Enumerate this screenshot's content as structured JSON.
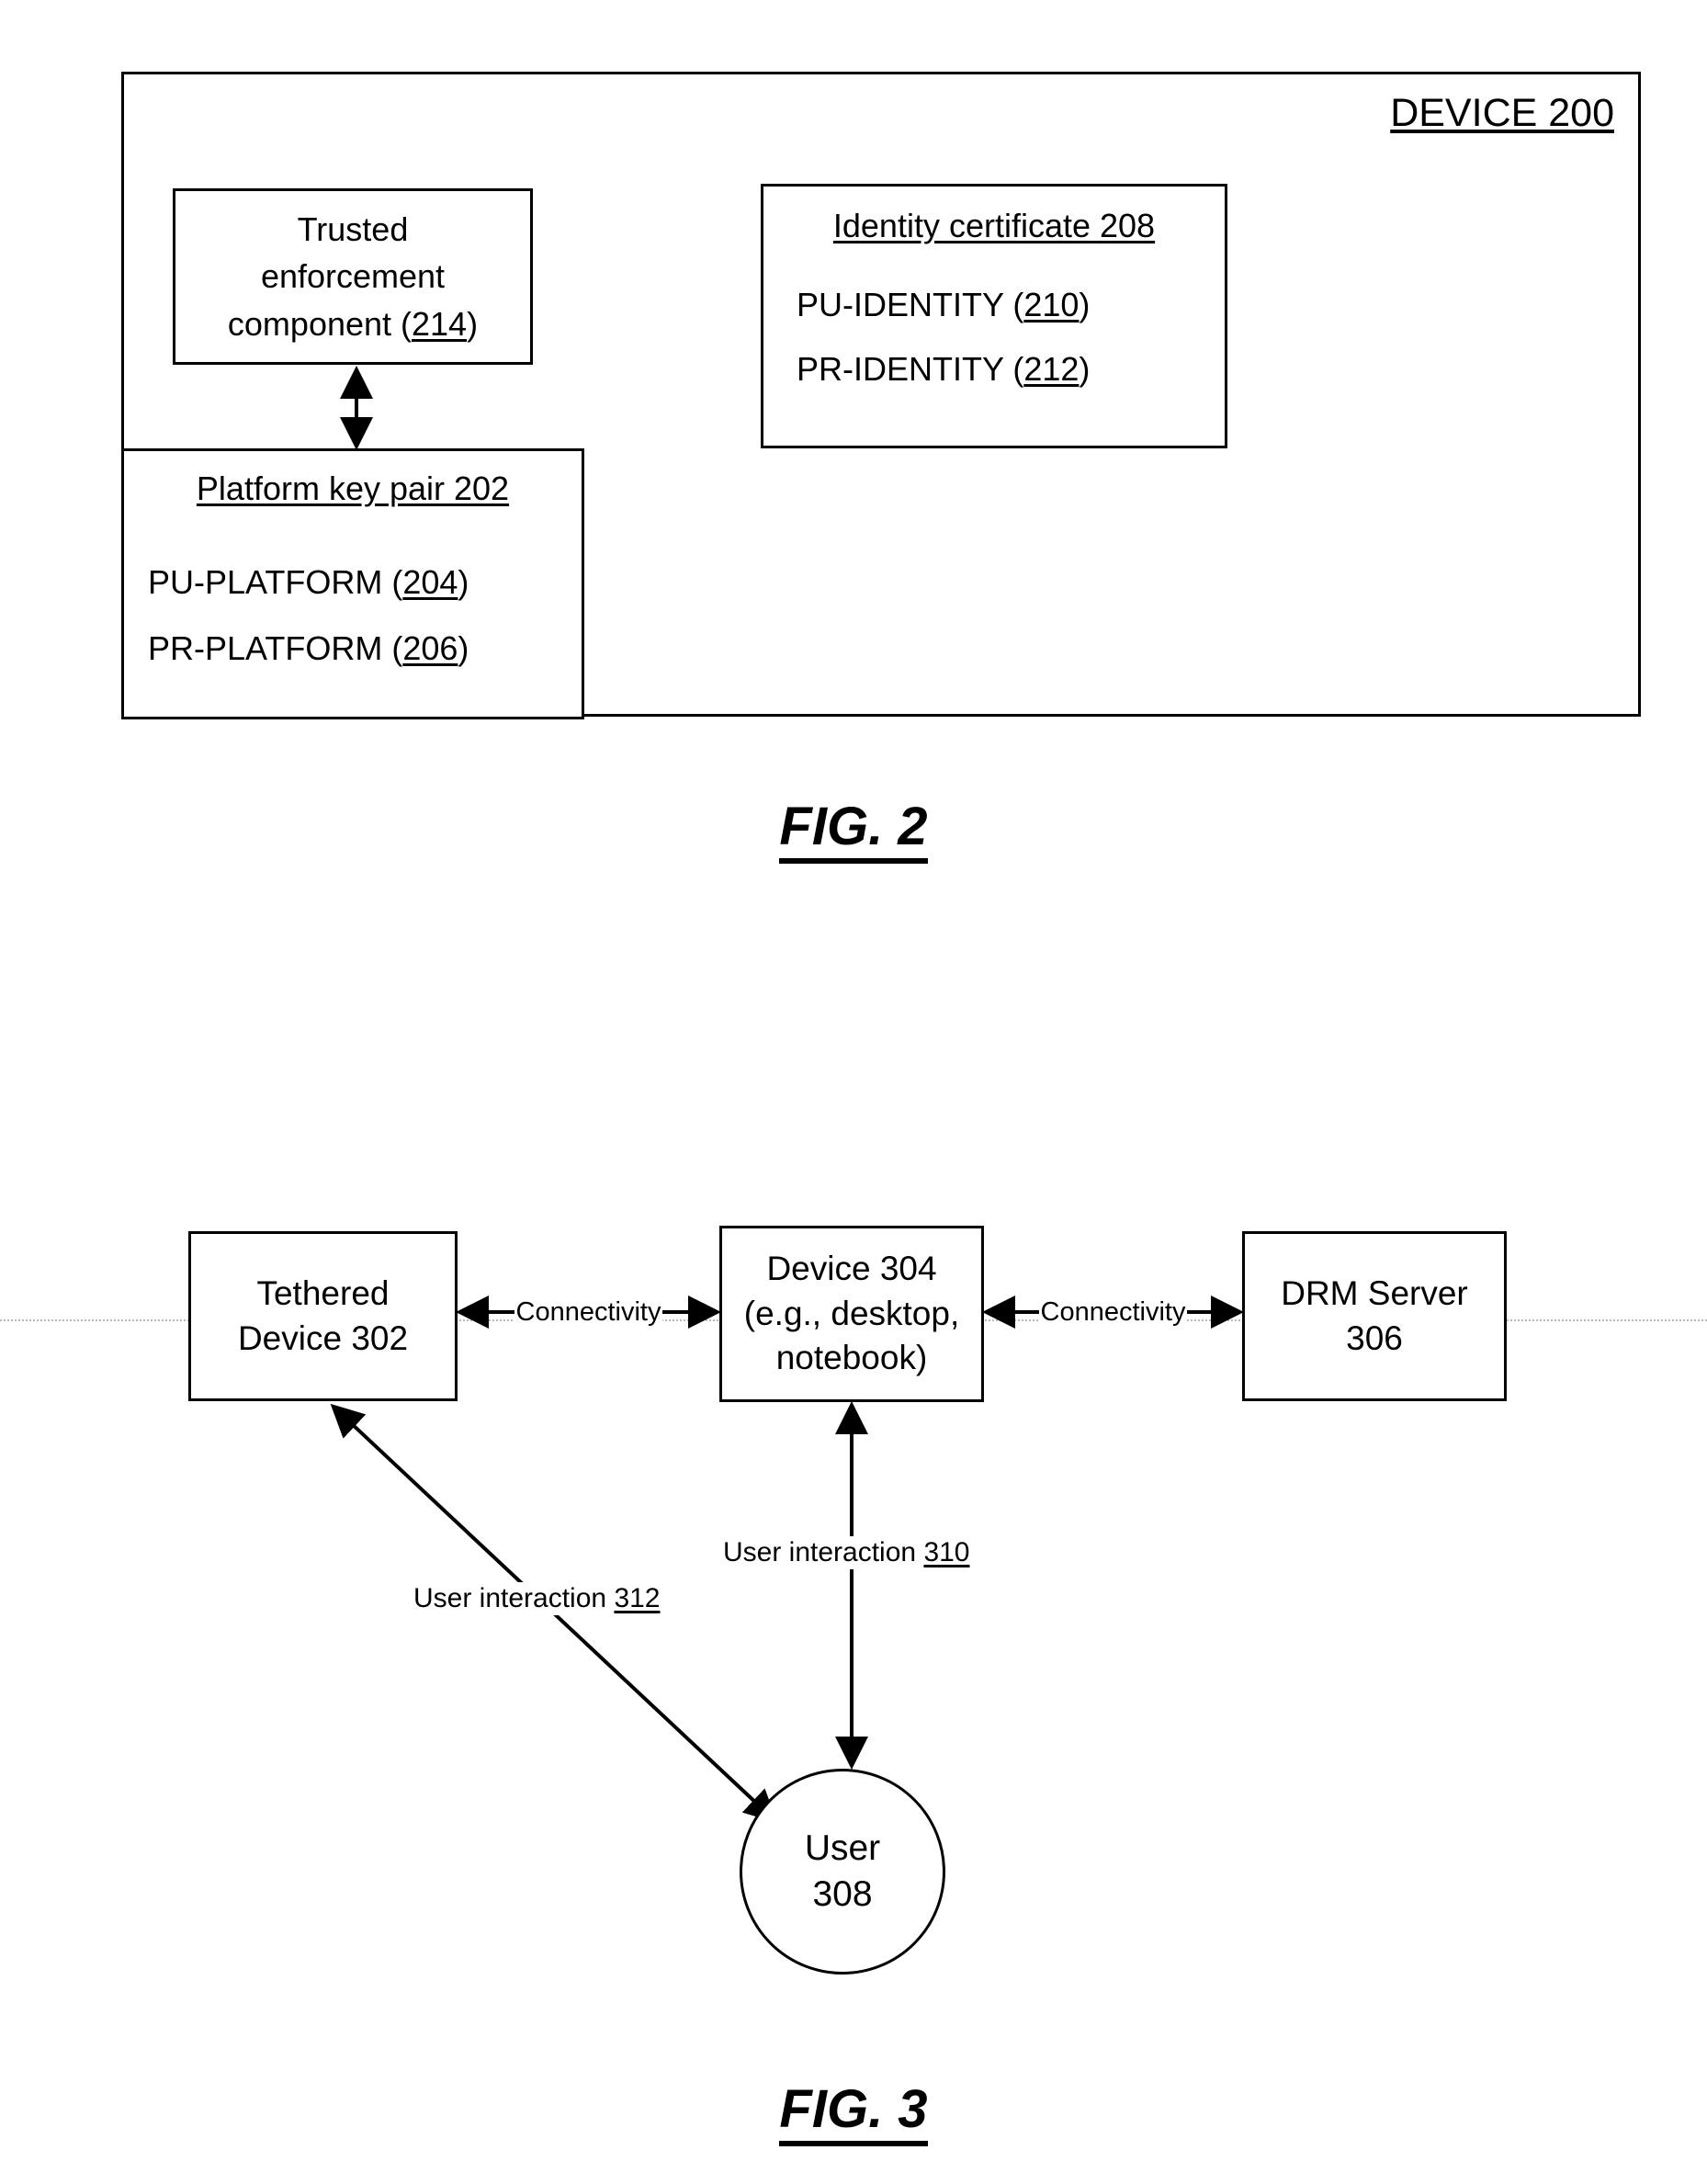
{
  "figure2": {
    "caption": "FIG. 2",
    "outer_label": "DEVICE 200",
    "trusted_enforcement": {
      "line1": "Trusted",
      "line2": "enforcement",
      "line3_prefix": "component (",
      "line3_ref": "214",
      "line3_suffix": ")"
    },
    "identity_certificate": {
      "title": "Identity certificate 208",
      "pu_prefix": "PU-IDENTITY (",
      "pu_ref": "210",
      "pu_suffix": ")",
      "pr_prefix": "PR-IDENTITY (",
      "pr_ref": "212",
      "pr_suffix": ")"
    },
    "platform_key_pair": {
      "title": "Platform key pair 202",
      "pu_prefix": "PU-PLATFORM (",
      "pu_ref": "204",
      "pu_suffix": ")",
      "pr_prefix": "PR-PLATFORM (",
      "pr_ref": "206",
      "pr_suffix": ")"
    }
  },
  "figure3": {
    "caption": "FIG. 3",
    "tethered_device": {
      "line1": "Tethered",
      "line2": "Device 302"
    },
    "device304": {
      "line1": "Device 304",
      "line2": "(e.g., desktop,",
      "line3": "notebook)"
    },
    "drm_server": {
      "line1": "DRM Server",
      "line2": "306"
    },
    "user": {
      "line1": "User",
      "line2": "308"
    },
    "connectivity_left": "Connectivity",
    "connectivity_right": "Connectivity",
    "user_interaction_312_prefix": "User interaction ",
    "user_interaction_312_ref": "312",
    "user_interaction_310_prefix": "User interaction ",
    "user_interaction_310_ref": "310"
  },
  "colors": {
    "ink": "#000000",
    "paper": "#ffffff",
    "guideline": "#b9b9b9"
  }
}
